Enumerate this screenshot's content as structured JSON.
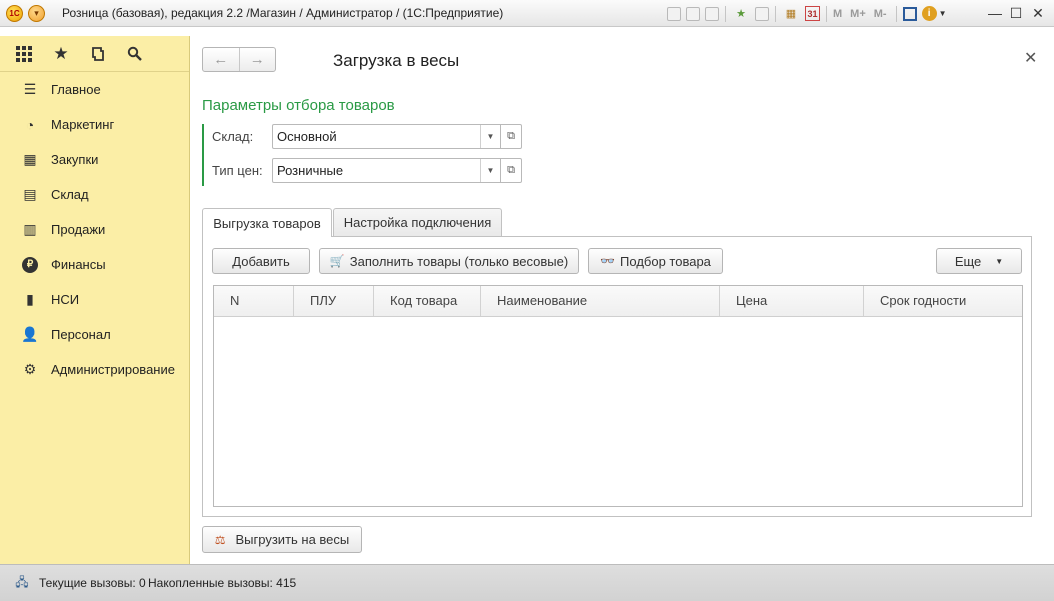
{
  "window": {
    "title": "Розница (базовая), редакция 2.2 /Магазин / Администратор /  (1С:Предприятие)",
    "logo_text": "1С",
    "toolbar_icons": [
      "save-icon",
      "print-icon",
      "preview-icon",
      "favorites-icon",
      "history-icon",
      "calculator-icon",
      "calendar-icon",
      "m-memory-icon",
      "m-plus-icon",
      "m-minus-icon",
      "panels-icon",
      "info-icon"
    ],
    "memory_labels": {
      "m": "M",
      "m_plus": "M+",
      "m_minus": "M-"
    },
    "calendar_day": "31"
  },
  "sidebar": {
    "top_icons": [
      "apps-grid-icon",
      "star-icon",
      "history-icon",
      "search-icon"
    ],
    "items": [
      {
        "label": "Главное",
        "icon": "menu-lines-icon"
      },
      {
        "label": "Маркетинг",
        "icon": "pie-chart-icon"
      },
      {
        "label": "Закупки",
        "icon": "cart-icon"
      },
      {
        "label": "Склад",
        "icon": "warehouse-icon"
      },
      {
        "label": "Продажи",
        "icon": "basket-icon"
      },
      {
        "label": "Финансы",
        "icon": "ruble-icon"
      },
      {
        "label": "НСИ",
        "icon": "catalog-icon"
      },
      {
        "label": "Персонал",
        "icon": "person-icon"
      },
      {
        "label": "Администрирование",
        "icon": "gear-icon"
      }
    ]
  },
  "form": {
    "title": "Загрузка в весы",
    "section_title": "Параметры отбора товаров",
    "fields": {
      "warehouse": {
        "label": "Склад:",
        "value": "Основной"
      },
      "price_type": {
        "label": "Тип цен:",
        "value": "Розничные"
      }
    },
    "tabs": [
      {
        "label": "Выгрузка товаров",
        "active": true
      },
      {
        "label": "Настройка подключения",
        "active": false
      }
    ],
    "toolbar": {
      "add": "Добавить",
      "fill": "Заполнить товары (только весовые)",
      "pick": "Подбор товара",
      "more": "Еще"
    },
    "table": {
      "columns": [
        "N",
        "ПЛУ",
        "Код товара",
        "Наименование",
        "Цена",
        "Срок годности"
      ],
      "rows": []
    },
    "upload_button": "Выгрузить на весы"
  },
  "statusbar": {
    "current_calls": "Текущие вызовы: 0",
    "accumulated_calls": "Накопленные вызовы: 415"
  },
  "colors": {
    "sidebar_bg": "#fbeea6",
    "accent_green": "#2a9a45",
    "statusbar_bg": "#d6d6d6"
  }
}
